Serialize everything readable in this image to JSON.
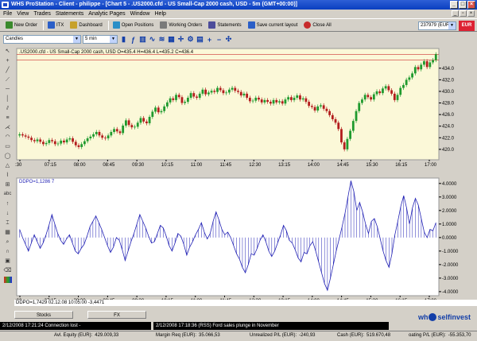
{
  "window": {
    "title": "WHS ProStation - Client - philippe - [Chart 5 - .US2000.cfd - US Small-Cap 2000 cash, USD - 5m (GMT+00:00)]"
  },
  "menu": [
    "File",
    "View",
    "Trades",
    "Statements",
    "Analytic Pages",
    "Window",
    "Help"
  ],
  "toolbar": {
    "buttons": [
      {
        "label": "New Order",
        "icon": "new-order-icon",
        "color": "#3b8a2c"
      },
      {
        "label": "ITX",
        "icon": "itx-icon",
        "color": "#2b5fc7"
      },
      {
        "label": "Dashboard",
        "icon": "dashboard-icon",
        "color": "#c7a12b"
      },
      {
        "label": "Open Positions",
        "icon": "open-positions-icon",
        "color": "#2b8fc7"
      },
      {
        "label": "Working Orders",
        "icon": "working-orders-icon",
        "color": "#7a7a7a"
      },
      {
        "label": "Statements",
        "icon": "statements-icon",
        "color": "#4c4c9a"
      },
      {
        "label": "Save current layout",
        "icon": "save-icon",
        "color": "#2b5fc7"
      },
      {
        "label": "Close All",
        "icon": "close-all-icon",
        "color": "#c72b2b"
      }
    ],
    "account": "237979 (EUR)",
    "currency": "EUR"
  },
  "chart_toolbar": {
    "chart_type": "Candles",
    "interval": "5 min"
  },
  "chart_data": [
    {
      "type": "candlestick",
      "header": ".US2000.cfd - US Small-Cap 2000 cash, USD O=435.4 H=436.4 L=435.2 C=436.4",
      "y_ticks": [
        "420.0",
        "422.0",
        "424.0",
        "426.0",
        "428.0",
        "430.0",
        "432.0",
        "434.0"
      ],
      "x_ticks": [
        ":30",
        "07:15",
        "08:00",
        "08:45",
        "09:30",
        "10:15",
        "11:00",
        "11:45",
        "12:30",
        "13:15",
        "14:00",
        "14:45",
        "15:30",
        "16:15",
        "17:00"
      ],
      "ylim": [
        418.2,
        437.4
      ],
      "closes": [
        422.6,
        422.4,
        422.2,
        422.0,
        421.6,
        421.4,
        421.7,
        421.3,
        420.9,
        421.1,
        421.6,
        421.4,
        420.9,
        421.0,
        421.5,
        421.2,
        421.7,
        421.9,
        421.3,
        420.7,
        420.4,
        420.9,
        421.4,
        421.9,
        422.2,
        422.6,
        423.0,
        422.4,
        422.0,
        421.9,
        422.4,
        423.0,
        423.5,
        423.1,
        422.8,
        424.1,
        425.0,
        424.2,
        423.8,
        423.9,
        424.6,
        425.4,
        424.8,
        424.5,
        425.6,
        426.5,
        427.2,
        426.4,
        426.6,
        427.4,
        428.1,
        428.8,
        428.5,
        429.4,
        429.0,
        428.0,
        428.2,
        428.9,
        429.7,
        429.1,
        428.9,
        429.6,
        430.3,
        429.5,
        429.8,
        430.1,
        429.9,
        430.6,
        430.2,
        429.7,
        429.8,
        430.3,
        430.6,
        430.1,
        429.9,
        429.3,
        429.6,
        428.9,
        428.3,
        428.4,
        428.9,
        428.6,
        428.1,
        428.5,
        428.2,
        427.9,
        428.5,
        428.1,
        428.3,
        427.9,
        428.6,
        429.0,
        428.5,
        428.9,
        429.3,
        428.6,
        428.8,
        428.2,
        427.5,
        427.3,
        426.7,
        427.4,
        427.6,
        427.0,
        426.6,
        425.9,
        425.2,
        424.6,
        423.5,
        421.2,
        420.0,
        421.8,
        423.2,
        424.9,
        426.6,
        428.0,
        428.6,
        429.4,
        429.0,
        428.6,
        429.5,
        430.0,
        429.7,
        430.5,
        430.9,
        430.2,
        429.6,
        428.5,
        429.4,
        430.6,
        431.1,
        432.0,
        432.4,
        433.1,
        434.2,
        433.8,
        434.6,
        435.2,
        434.2,
        435.0,
        435.4,
        436.4
      ]
    },
    {
      "type": "oscillator",
      "header": "DDPO=1,1286 7",
      "y_ticks": [
        "4.0000",
        "3.0000",
        "2.0000",
        "1.0000",
        "0.0000",
        "-1.0000",
        "-2.0000",
        "-3.0000",
        "-4.0000"
      ],
      "ylim": [
        -4.3,
        4.4
      ],
      "values": [
        0.6,
        0.0,
        -0.5,
        -1.0,
        -0.4,
        0.2,
        -0.3,
        -0.8,
        -0.4,
        0.2,
        0.9,
        1.7,
        1.0,
        0.3,
        -0.2,
        -0.5,
        -0.1,
        0.2,
        -0.4,
        -1.0,
        -1.2,
        -0.8,
        -0.5,
        0.1,
        0.8,
        1.2,
        1.6,
        1.1,
        0.6,
        0.0,
        -0.6,
        -1.1,
        -0.7,
        0.0,
        -0.2,
        -0.9,
        -1.7,
        -1.0,
        -0.3,
        0.3,
        1.0,
        1.7,
        1.2,
        0.7,
        0.1,
        -0.4,
        -0.3,
        0.3,
        0.9,
        0.7,
        0.1,
        -0.6,
        -1.0,
        -0.4,
        0.3,
        0.1,
        -0.5,
        -1.3,
        -0.7,
        -0.3,
        0.2,
        0.6,
        1.1,
        0.4,
        -0.1,
        0.3,
        1.2,
        1.9,
        1.3,
        0.6,
        0.2,
        0.4,
        0.0,
        -0.6,
        -1.2,
        -1.6,
        -2.2,
        -2.6,
        -2.0,
        -1.2,
        -1.3,
        -0.8,
        -0.2,
        0.2,
        -0.3,
        -1.0,
        -1.4,
        -1.0,
        -0.4,
        0.2,
        0.9,
        0.5,
        -0.2,
        -0.4,
        -0.9,
        -1.5,
        -1.8,
        -1.1,
        -1.2,
        -0.6,
        -0.3,
        -1.0,
        -1.8,
        -2.6,
        -3.4,
        -3.9,
        -3.0,
        -2.0,
        -1.0,
        -0.1,
        0.8,
        1.8,
        3.0,
        4.2,
        3.4,
        2.0,
        2.6,
        1.9,
        1.0,
        0.3,
        1.2,
        1.4,
        0.8,
        -0.1,
        -1.0,
        -1.7,
        -2.2,
        -1.2,
        0.2,
        1.2,
        2.3,
        3.1,
        2.2,
        1.0,
        2.2,
        2.9,
        2.4,
        1.4,
        0.4,
        0.0,
        0.6,
        0.5,
        1.1
      ]
    }
  ],
  "status": {
    "readout": "DDPO=1,7429  02.12.08 10:05:00 -3,4471"
  },
  "tabs": [
    "Stocks",
    "FX"
  ],
  "brand": {
    "left": "wh",
    "right": "selfinvest"
  },
  "news": [
    "2/12/2008 17:21:24 Connection lost -",
    "2/12/2008 17:18:36 (RSS) Ford sales plunge in November"
  ],
  "metrics": [
    {
      "label": "Avl. Equity (EUR):",
      "value": "429.009,33"
    },
    {
      "label": "Margin Req (EUR):",
      "value": "35.066,53"
    },
    {
      "label": "Unrealized P/L (EUR):",
      "value": "-240,93"
    },
    {
      "label": "Cash (EUR):",
      "value": "519.670,48"
    },
    {
      "label": "oating P/L (EUR):",
      "value": "-55.353,70"
    }
  ],
  "colors": {
    "chart_bg": "#fbf8d8",
    "bull": "#1f9a2e",
    "bear": "#b31d1d",
    "oscillator": "#2323b5"
  }
}
